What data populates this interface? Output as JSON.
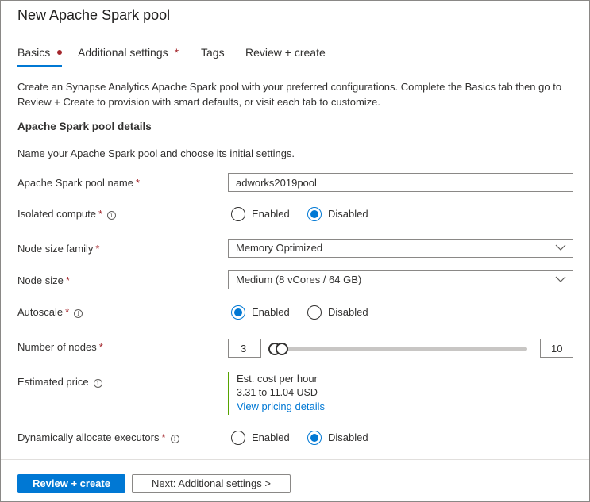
{
  "title": "New Apache Spark pool",
  "tabs": [
    {
      "label": "Basics"
    },
    {
      "label": "Additional settings",
      "marker": "*"
    },
    {
      "label": "Tags"
    },
    {
      "label": "Review + create"
    }
  ],
  "intro": "Create an Synapse Analytics Apache Spark pool with your preferred configurations. Complete the Basics tab then go to Review + Create to provision with smart defaults, or visit each tab to customize.",
  "section": {
    "heading": "Apache Spark pool details",
    "subheading": "Name your Apache Spark pool and choose its initial settings."
  },
  "form": {
    "required_marker": "*",
    "info_glyph": "i",
    "pool_name": {
      "label": "Apache Spark pool name",
      "value": "adworks2019pool"
    },
    "isolated_compute": {
      "label": "Isolated compute",
      "options": [
        "Enabled",
        "Disabled"
      ],
      "selected": "Disabled"
    },
    "node_size_family": {
      "label": "Node size family",
      "value": "Memory Optimized"
    },
    "node_size": {
      "label": "Node size",
      "value": "Medium (8 vCores / 64 GB)"
    },
    "autoscale": {
      "label": "Autoscale",
      "options": [
        "Enabled",
        "Disabled"
      ],
      "selected": "Enabled"
    },
    "number_of_nodes": {
      "label": "Number of nodes",
      "min": "3",
      "max": "10"
    },
    "estimated_price": {
      "label": "Estimated price",
      "heading": "Est. cost per hour",
      "range": "3.31 to 11.04 USD",
      "link": "View pricing details"
    },
    "dynamic_executors": {
      "label": "Dynamically allocate executors",
      "options": [
        "Enabled",
        "Disabled"
      ],
      "selected": "Disabled"
    }
  },
  "footer": {
    "primary": "Review + create",
    "secondary": "Next: Additional settings >"
  },
  "colors": {
    "accent": "#0078d4",
    "required": "#a4262c",
    "price_bar": "#57a300"
  }
}
